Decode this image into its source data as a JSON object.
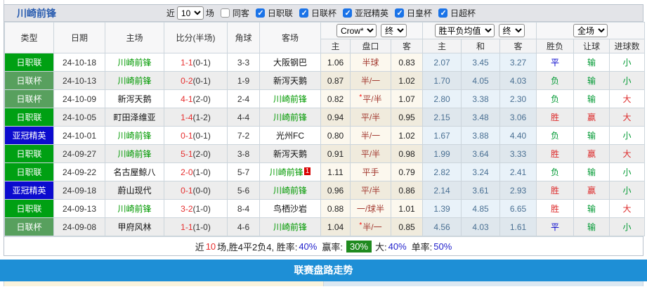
{
  "title": "川崎前锋",
  "filters": {
    "near_label": "近",
    "near_value": "10",
    "games_label": "场",
    "same_away": {
      "label": "同客",
      "checked": "false"
    },
    "leagues": [
      {
        "label": "日职联",
        "checked": "true"
      },
      {
        "label": "日联杯",
        "checked": "true"
      },
      {
        "label": "亚冠精英",
        "checked": "true"
      },
      {
        "label": "日皇杯",
        "checked": "true"
      },
      {
        "label": "日超杯",
        "checked": "true"
      }
    ]
  },
  "table": {
    "headers": [
      "类型",
      "日期",
      "主场",
      "比分(半场)",
      "角球",
      "客场"
    ],
    "selects": {
      "company": "Crow*",
      "company_time": "终",
      "avg": "胜平负均值",
      "avg_time": "终",
      "scope": "全场"
    },
    "sub_headers": [
      "主",
      "盘口",
      "客",
      "主",
      "和",
      "客",
      "胜负",
      "让球",
      "进球数"
    ],
    "rows": [
      {
        "league": "日职联",
        "league_color": "green",
        "date": "24-10-18",
        "home": "川崎前锋",
        "home_self": "self",
        "score": "1-1",
        "half": "(0-1)",
        "corners": "3-3",
        "away": "大阪钢巴",
        "away_self": "other",
        "away_sup": "",
        "h_odds": "1.06",
        "handicap_star": "",
        "handicap": "半球",
        "a_odds": "0.83",
        "avg_h": "2.07",
        "avg_d": "3.45",
        "avg_a": "3.27",
        "result": "平",
        "result_color": "blue",
        "give": "输",
        "give_color": "green",
        "goals": "小",
        "goals_color": "green"
      },
      {
        "league": "日联杯",
        "league_color": "dull",
        "date": "24-10-13",
        "home": "川崎前锋",
        "home_self": "self",
        "score": "0-2",
        "half": "(0-1)",
        "corners": "1-9",
        "away": "新泻天鹅",
        "away_self": "other",
        "away_sup": "",
        "h_odds": "0.87",
        "handicap_star": "",
        "handicap": "半/一",
        "a_odds": "1.02",
        "avg_h": "1.70",
        "avg_d": "4.05",
        "avg_a": "4.03",
        "result": "负",
        "result_color": "green",
        "give": "输",
        "give_color": "green",
        "goals": "小",
        "goals_color": "green"
      },
      {
        "league": "日联杯",
        "league_color": "dull",
        "date": "24-10-09",
        "home": "新泻天鹅",
        "home_self": "other",
        "score": "4-1",
        "half": "(2-0)",
        "corners": "2-4",
        "away": "川崎前锋",
        "away_self": "self",
        "away_sup": "",
        "h_odds": "0.82",
        "handicap_star": "*",
        "handicap": "平/半",
        "a_odds": "1.07",
        "avg_h": "2.80",
        "avg_d": "3.38",
        "avg_a": "2.30",
        "result": "负",
        "result_color": "green",
        "give": "输",
        "give_color": "green",
        "goals": "大",
        "goals_color": "red"
      },
      {
        "league": "日职联",
        "league_color": "green",
        "date": "24-10-05",
        "home": "町田泽维亚",
        "home_self": "other",
        "score": "1-4",
        "half": "(1-2)",
        "corners": "4-4",
        "away": "川崎前锋",
        "away_self": "self",
        "away_sup": "",
        "h_odds": "0.94",
        "handicap_star": "",
        "handicap": "平/半",
        "a_odds": "0.95",
        "avg_h": "2.15",
        "avg_d": "3.48",
        "avg_a": "3.06",
        "result": "胜",
        "result_color": "red",
        "give": "赢",
        "give_color": "red",
        "goals": "大",
        "goals_color": "red"
      },
      {
        "league": "亚冠精英",
        "league_color": "blue",
        "date": "24-10-01",
        "home": "川崎前锋",
        "home_self": "self",
        "score": "0-1",
        "half": "(0-1)",
        "corners": "7-2",
        "away": "光州FC",
        "away_self": "other",
        "away_sup": "",
        "h_odds": "0.80",
        "handicap_star": "",
        "handicap": "半/一",
        "a_odds": "1.02",
        "avg_h": "1.67",
        "avg_d": "3.88",
        "avg_a": "4.40",
        "result": "负",
        "result_color": "green",
        "give": "输",
        "give_color": "green",
        "goals": "小",
        "goals_color": "green"
      },
      {
        "league": "日职联",
        "league_color": "green",
        "date": "24-09-27",
        "home": "川崎前锋",
        "home_self": "self",
        "score": "5-1",
        "half": "(2-0)",
        "corners": "3-8",
        "away": "新泻天鹅",
        "away_self": "other",
        "away_sup": "",
        "h_odds": "0.91",
        "handicap_star": "",
        "handicap": "平/半",
        "a_odds": "0.98",
        "avg_h": "1.99",
        "avg_d": "3.64",
        "avg_a": "3.33",
        "result": "胜",
        "result_color": "red",
        "give": "赢",
        "give_color": "red",
        "goals": "大",
        "goals_color": "red"
      },
      {
        "league": "日职联",
        "league_color": "green",
        "date": "24-09-22",
        "home": "名古屋鲸八",
        "home_self": "other",
        "score": "2-0",
        "half": "(1-0)",
        "corners": "5-7",
        "away": "川崎前锋",
        "away_self": "self",
        "away_sup": "1",
        "h_odds": "1.11",
        "handicap_star": "",
        "handicap": "平手",
        "a_odds": "0.79",
        "avg_h": "2.82",
        "avg_d": "3.24",
        "avg_a": "2.41",
        "result": "负",
        "result_color": "green",
        "give": "输",
        "give_color": "green",
        "goals": "小",
        "goals_color": "green"
      },
      {
        "league": "亚冠精英",
        "league_color": "blue",
        "date": "24-09-18",
        "home": "蔚山现代",
        "home_self": "other",
        "score": "0-1",
        "half": "(0-0)",
        "corners": "5-6",
        "away": "川崎前锋",
        "away_self": "self",
        "away_sup": "",
        "h_odds": "0.96",
        "handicap_star": "",
        "handicap": "平/半",
        "a_odds": "0.86",
        "avg_h": "2.14",
        "avg_d": "3.61",
        "avg_a": "2.93",
        "result": "胜",
        "result_color": "red",
        "give": "赢",
        "give_color": "red",
        "goals": "小",
        "goals_color": "green"
      },
      {
        "league": "日职联",
        "league_color": "green",
        "date": "24-09-13",
        "home": "川崎前锋",
        "home_self": "self",
        "score": "3-2",
        "half": "(1-0)",
        "corners": "8-4",
        "away": "鸟栖沙岩",
        "away_self": "other",
        "away_sup": "",
        "h_odds": "0.88",
        "handicap_star": "",
        "handicap": "一/球半",
        "a_odds": "1.01",
        "avg_h": "1.39",
        "avg_d": "4.85",
        "avg_a": "6.65",
        "result": "胜",
        "result_color": "red",
        "give": "输",
        "give_color": "green",
        "goals": "大",
        "goals_color": "red"
      },
      {
        "league": "日联杯",
        "league_color": "dull",
        "date": "24-09-08",
        "home": "甲府风林",
        "home_self": "other",
        "score": "1-1",
        "half": "(1-0)",
        "corners": "4-6",
        "away": "川崎前锋",
        "away_self": "self",
        "away_sup": "",
        "h_odds": "1.04",
        "handicap_star": "*",
        "handicap": "半/一",
        "a_odds": "0.85",
        "avg_h": "4.56",
        "avg_d": "4.03",
        "avg_a": "1.61",
        "result": "平",
        "result_color": "blue",
        "give": "输",
        "give_color": "green",
        "goals": "小",
        "goals_color": "green"
      }
    ]
  },
  "summary": {
    "near": "近",
    "count": "10",
    "record": "场,胜4平2负4, 胜率:",
    "win_rate": "40%",
    "profit_label": "赢率:",
    "profit_rate": "30%",
    "big_label": "大:",
    "big_rate": "40%",
    "single_label": "单率:",
    "single_rate": "50%"
  },
  "footer_bar": {
    "label": "联赛盘路走势"
  },
  "colors": {
    "accent_blue": "#2a5db0",
    "league_green": "#00a013",
    "league_dull_green": "#58a05e",
    "league_blue": "#0b0bce",
    "win_red": "#dd2a2a",
    "draw_blue": "#0000cc",
    "lose_green": "#009933",
    "handicap_red": "#a33b32",
    "avg_blue": "#4a7093",
    "bar_blue": "#1e8fd6",
    "rate_green": "#1f8a1f"
  }
}
